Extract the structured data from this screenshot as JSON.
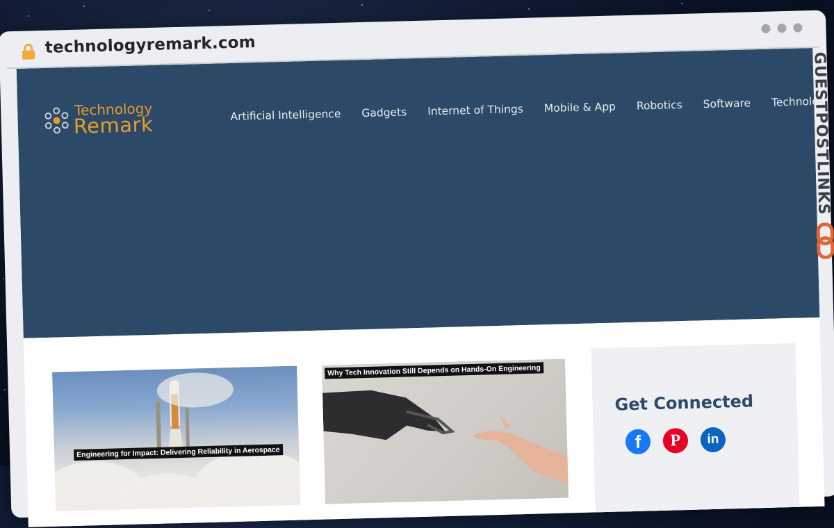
{
  "browser": {
    "url": "technologyremark.com",
    "icons": {
      "lock": "lock-icon",
      "window_dots": [
        "dot",
        "dot",
        "dot"
      ]
    }
  },
  "site": {
    "logo": {
      "top": "Technology",
      "bottom": "Remark"
    },
    "colors": {
      "header_bg": "#2c4a68",
      "logo_orange": "#e89b2c"
    },
    "nav": [
      {
        "label": "Artificial Intelligence"
      },
      {
        "label": "Gadgets"
      },
      {
        "label": "Internet of Things"
      },
      {
        "label": "Mobile & App"
      },
      {
        "label": "Robotics"
      },
      {
        "label": "Software"
      },
      {
        "label": "Technology"
      }
    ]
  },
  "articles": [
    {
      "caption": "Engineering for Impact: Delivering Reliability in Aerospace"
    },
    {
      "caption": "Why Tech Innovation Still Depends on Hands-On Engineering"
    }
  ],
  "sidebar": {
    "title": "Get Connected",
    "social": [
      {
        "icon": "facebook-icon",
        "glyph": "f"
      },
      {
        "icon": "pinterest-icon",
        "glyph": "P"
      },
      {
        "icon": "linkedin-icon",
        "glyph": "in"
      }
    ]
  },
  "watermark": {
    "text": "GUESTPOSTLINKS"
  }
}
